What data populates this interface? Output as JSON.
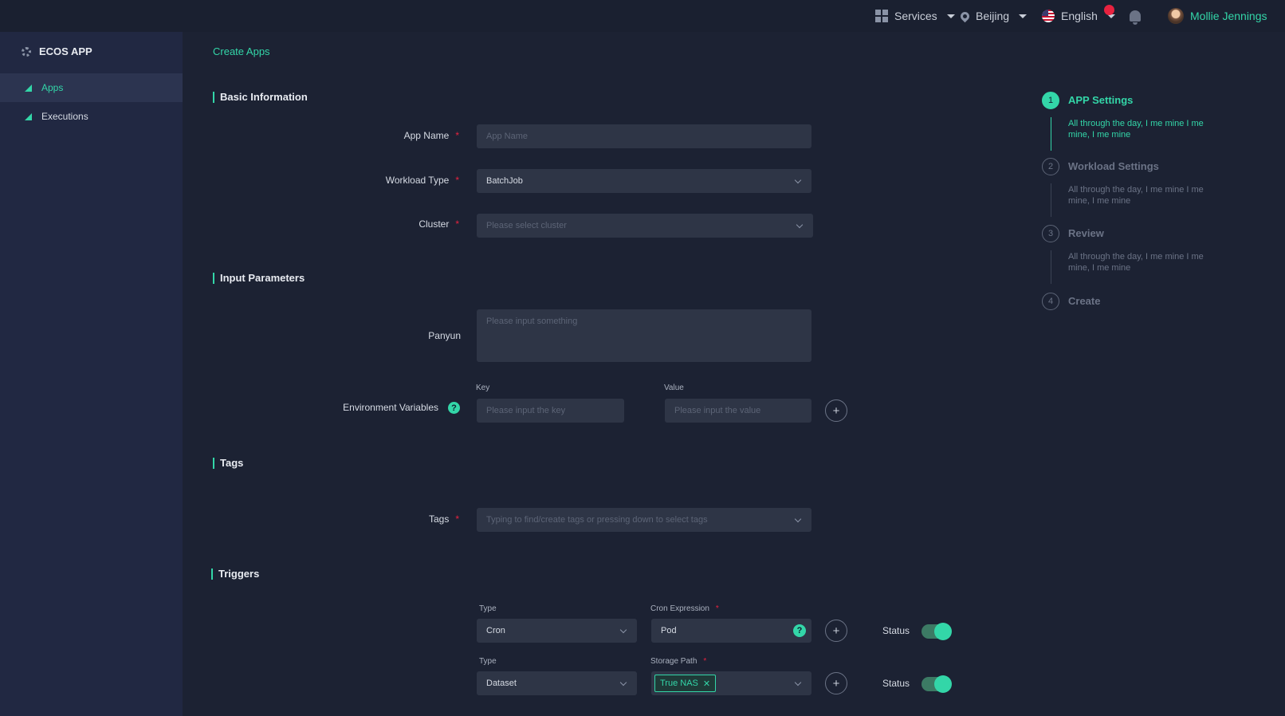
{
  "topbar": {
    "services": "Services",
    "region": "Beijing",
    "language": "English",
    "user_name": "Mollie Jennings"
  },
  "sidebar": {
    "brand": "ECOS APP",
    "items": [
      {
        "label": "Apps"
      },
      {
        "label": "Executions"
      }
    ]
  },
  "breadcrumb": "Create Apps",
  "basic": {
    "title": "Basic Information",
    "app_name_label": "App Name",
    "app_name_placeholder": "App Name",
    "workload_type_label": "Workload Type",
    "workload_type_value": "BatchJob",
    "cluster_label": "Cluster",
    "cluster_placeholder": "Please select cluster"
  },
  "inputs": {
    "title": "Input Parameters",
    "panyun_label": "Panyun",
    "panyun_placeholder": "Please input something",
    "env_label": "Environment Variables",
    "key_label": "Key",
    "key_placeholder": "Please input the key",
    "value_label": "Value",
    "value_placeholder": "Please input the value"
  },
  "tags": {
    "title": "Tags",
    "label": "Tags",
    "placeholder": "Typing to find/create tags or pressing down to select tags"
  },
  "triggers": {
    "title": "Triggers",
    "rows": [
      {
        "type_label": "Type",
        "type_value": "Cron",
        "second_label": "Cron Expression",
        "second_value": "Pod",
        "status_label": "Status"
      },
      {
        "type_label": "Type",
        "type_value": "Dataset",
        "second_label": "Storage Path",
        "chip": "True NAS",
        "status_label": "Status"
      }
    ]
  },
  "steps": [
    {
      "num": "1",
      "title": "APP Settings",
      "desc": "All through the day, I me mine I me mine, I me mine"
    },
    {
      "num": "2",
      "title": "Workload Settings",
      "desc": "All through the day, I me mine I me mine, I me mine"
    },
    {
      "num": "3",
      "title": "Review",
      "desc": "All through the day, I me mine I me mine, I me mine"
    },
    {
      "num": "4",
      "title": "Create"
    }
  ],
  "colors": {
    "accent": "#33d6a8",
    "background": "#1c2233",
    "sidebar": "#212842",
    "field": "#2e3546",
    "required": "#e8223f"
  }
}
